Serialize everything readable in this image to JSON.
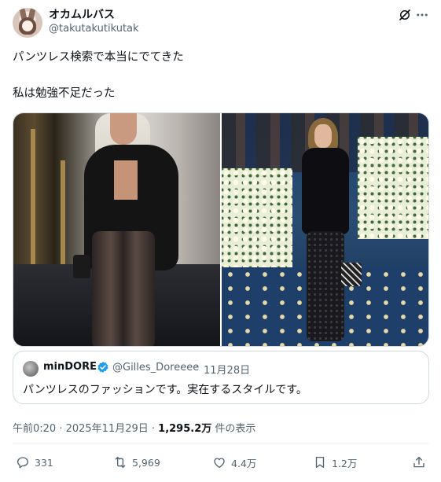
{
  "author": {
    "display_name": "オカムルバス",
    "handle": "@takutakutikutak"
  },
  "tweet": {
    "lines": [
      "パンツレス検索で本当にでてきた",
      "私は勉強不足だった"
    ]
  },
  "quote": {
    "author_name": "minDORE",
    "author_handle": "@Gilles_Doreeee",
    "separator": "·",
    "date": "11月28日",
    "text": "パンツレスのファッションです。実在するスタイルです。"
  },
  "meta": {
    "timestamp": "午前0:20 · 2025年11月29日 · ",
    "views_count": "1,295.2万",
    "views_label": " 件の表示"
  },
  "actions": {
    "replies": "331",
    "reposts": "5,969",
    "likes": "4.4万",
    "bookmarks": "1.2万"
  },
  "colors": {
    "text_primary": "#0f1419",
    "text_secondary": "#536471",
    "border": "#cfd9de",
    "verified": "#1d9bf0"
  },
  "icons": [
    "grok-icon",
    "more-icon",
    "verified-icon",
    "reply-icon",
    "repost-icon",
    "like-icon",
    "bookmark-icon",
    "share-icon"
  ]
}
